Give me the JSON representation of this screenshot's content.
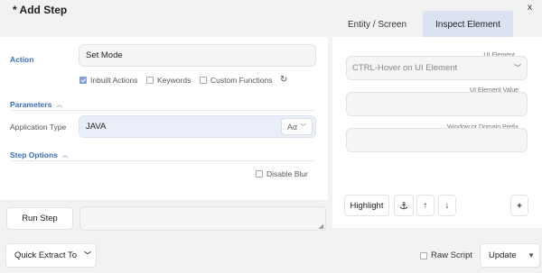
{
  "header": {
    "title": "* Add Step",
    "close_label": "x",
    "tabs": [
      {
        "label": "Entity / Screen"
      },
      {
        "label": "Inspect Element"
      }
    ]
  },
  "action": {
    "label": "Action",
    "value": "Set Mode",
    "options": [
      {
        "label": "Inbuilt Actions",
        "checked": true
      },
      {
        "label": "Keywords",
        "checked": false
      },
      {
        "label": "Custom Functions",
        "checked": false
      }
    ],
    "refresh_icon": "refresh-icon"
  },
  "parameters": {
    "label": "Parameters",
    "application_type_label": "Application Type",
    "application_type_value": "JAVA",
    "case_toggle_label": "Aα"
  },
  "step_options": {
    "label": "Step Options",
    "disable_blur_label": "Disable Blur"
  },
  "run": {
    "button_label": "Run Step",
    "output_value": ""
  },
  "inspect": {
    "ui_element_label": "UI Element",
    "ui_element_placeholder": "CTRL-Hover on UI Element",
    "ui_element_value_label": "UI Element Value",
    "window_prefix_label": "Window or Domain Prefix",
    "highlight_label": "Highlight",
    "anchor_icon": "⚓",
    "up_icon": "↑",
    "down_icon": "↓",
    "add_icon": "+"
  },
  "footer": {
    "quick_extract_label": "Quick Extract To",
    "raw_script_label": "Raw Script",
    "raw_script_checked": false,
    "update_label": "Update"
  }
}
